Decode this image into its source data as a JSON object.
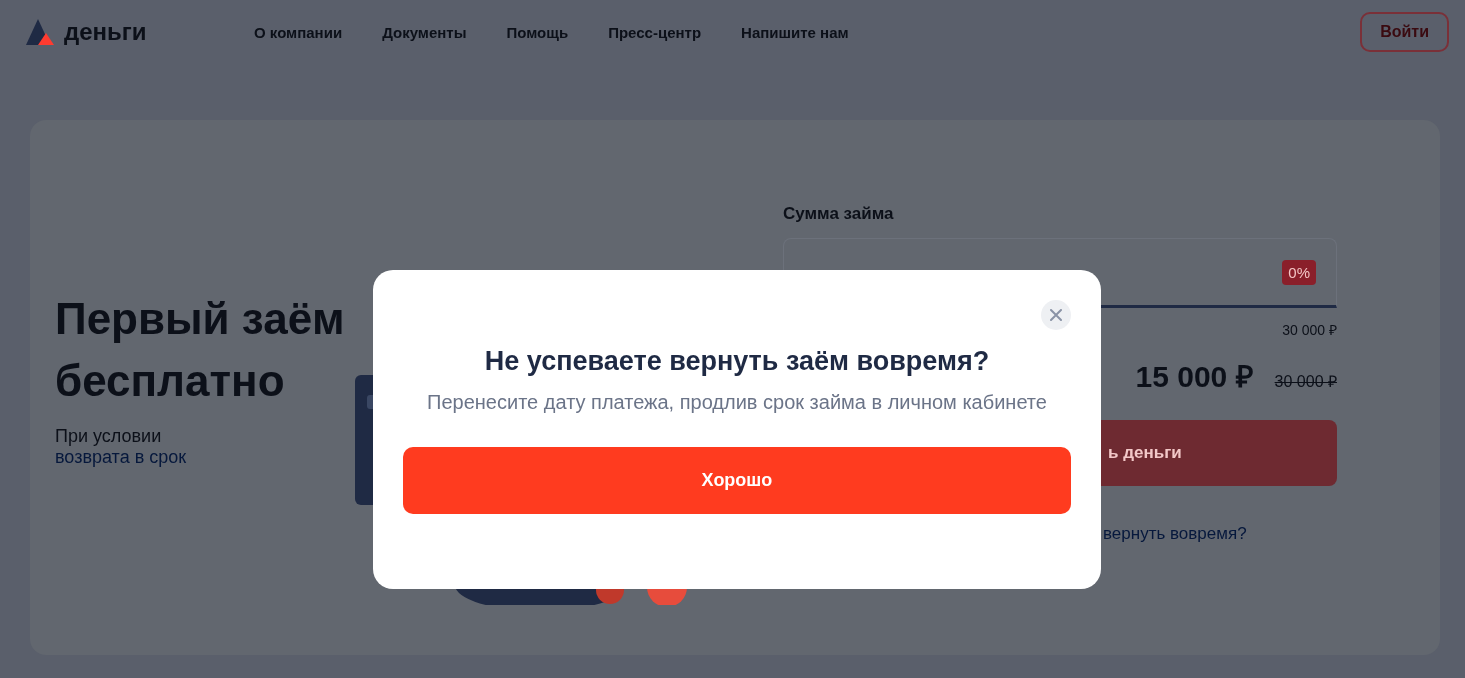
{
  "header": {
    "logo": "деньги",
    "nav": [
      "О компании",
      "Документы",
      "Помощь",
      "Пресс-центр",
      "Напишите нам"
    ],
    "login_button": "Войти"
  },
  "hero": {
    "title": "Первый заём бесплатно",
    "subtitle": "При условии",
    "link": "возврата в срок"
  },
  "loan_form": {
    "label": "Сумма займа",
    "badge": "0%",
    "max_hint": "30 000 ₽",
    "amount": "15 000 ₽",
    "old_amount": "30 000 ₽",
    "submit_button": "ь деньги",
    "link": "вернуть вовремя?"
  },
  "dialog": {
    "title": "Не успеваете вернуть заём вовремя?",
    "text": "Перенесите дату платежа, продлив срок займа в личном кабинете",
    "ok_button": "Хорошо"
  }
}
